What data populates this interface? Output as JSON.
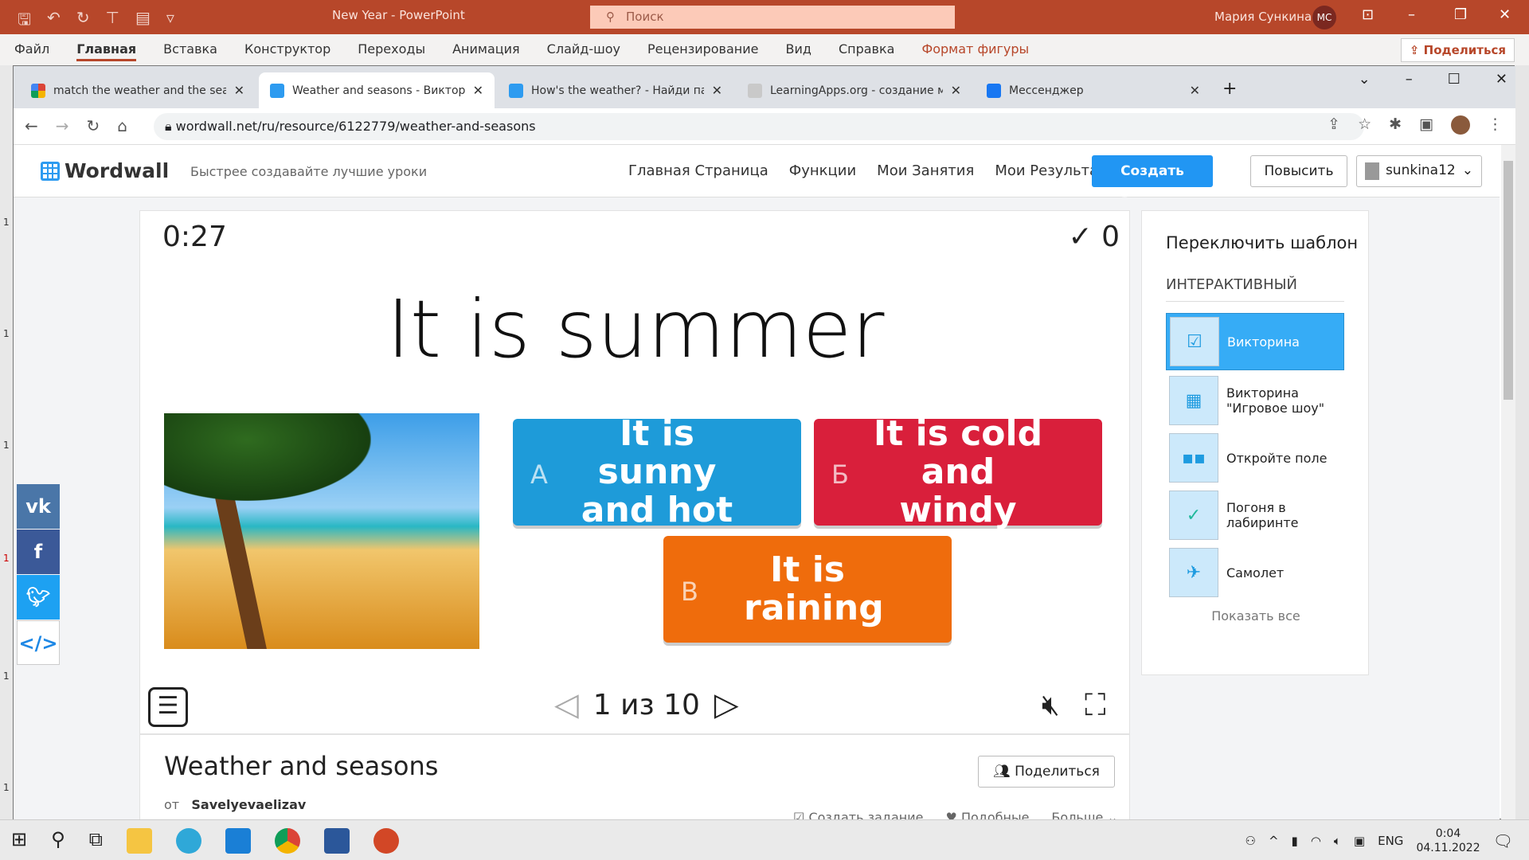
{
  "powerpoint": {
    "title": "New Year  -  PowerPoint",
    "search_placeholder": "Поиск",
    "user": "Мария Сункина",
    "user_initials": "МС",
    "ribbon_tabs": [
      "Файл",
      "Главная",
      "Вставка",
      "Конструктор",
      "Переходы",
      "Анимация",
      "Слайд-шоу",
      "Рецензирование",
      "Вид",
      "Справка",
      "Формат фигуры"
    ],
    "share": "Поделиться",
    "ruler_marks": [
      "1",
      "1",
      "1",
      "1",
      "1",
      "1"
    ]
  },
  "browser": {
    "tabs": [
      {
        "title": "match the weather and the seaso",
        "icon": "google-icon"
      },
      {
        "title": "Weather and seasons - Викторин",
        "icon": "wordwall-icon",
        "active": true
      },
      {
        "title": "How's the weather? - Найди пар",
        "icon": "wordwall-icon"
      },
      {
        "title": "LearningApps.org - создание му",
        "icon": "learningapps-icon"
      },
      {
        "title": "Мессенджер",
        "icon": "messenger-icon"
      }
    ],
    "url": "wordwall.net/ru/resource/6122779/weather-and-seasons"
  },
  "wordwall": {
    "logo": "Wordwall",
    "tagline": "Быстрее создавайте лучшие уроки",
    "nav": [
      "Главная Страница",
      "Функции",
      "Мои Занятия",
      "Мои Результаты"
    ],
    "create": "Создать Занятие",
    "upgrade": "Повысить",
    "username": "sunkina12"
  },
  "game": {
    "timer": "0:27",
    "score": "✓ 0",
    "question": "It is summer",
    "answers": [
      {
        "letter": "A",
        "text": "It is sunny and hot",
        "color": "#1e9bd9"
      },
      {
        "letter": "Б",
        "text": "It is cold and windy",
        "color": "#d91f3b"
      },
      {
        "letter": "В",
        "text": "It is raining",
        "color": "#ef6c0c"
      }
    ],
    "pager": "1 из 10"
  },
  "info": {
    "title": "Weather and seasons",
    "by_label": "от",
    "author": "Savelyevaelizav",
    "share": "Поделиться",
    "actions": [
      "Создать задание",
      "Подобные",
      "Больше"
    ]
  },
  "sidebar": {
    "title": "Переключить шаблон",
    "category": "ИНТЕРАКТИВНЫЙ",
    "templates": [
      "Викторина",
      "Викторина \"Игровое шоу\"",
      "Откройте поле",
      "Погоня в лабиринте",
      "Самолет"
    ],
    "show_all": "Показать все"
  },
  "social": [
    "vk",
    "f",
    "twitter",
    "</>"
  ],
  "taskbar": {
    "lang": "ENG",
    "time": "0:04",
    "date": "04.11.2022"
  }
}
